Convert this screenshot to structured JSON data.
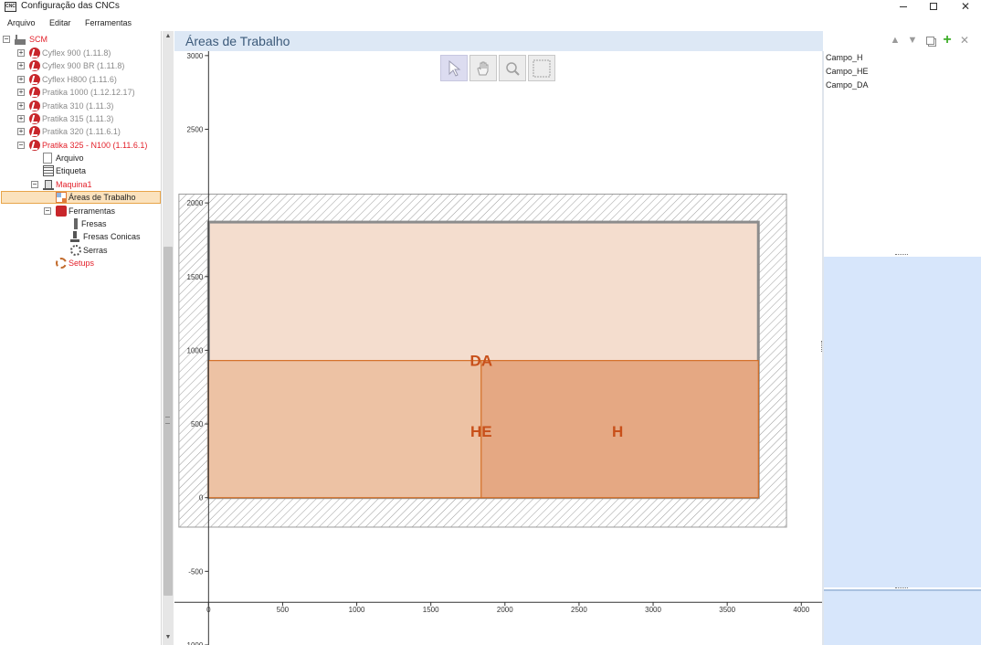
{
  "window": {
    "title": "Configuração das CNCs"
  },
  "menu": {
    "items": [
      "Arquivo",
      "Editar",
      "Ferramentas"
    ]
  },
  "tree": {
    "root": "SCM",
    "machines": [
      "Cyflex 900 (1.11.8)",
      "Cyflex 900 BR (1.11.8)",
      "Cyflex H800 (1.11.6)",
      "Pratika 1000 (1.12.12.17)",
      "Pratika 310 (1.11.3)",
      "Pratika 315 (1.11.3)",
      "Pratika 320 (1.11.6.1)",
      "Pratika 325 - N100 (1.11.6.1)"
    ],
    "children": {
      "arquivo": "Arquivo",
      "etiqueta": "Etiqueta",
      "maquina": "Maquina1",
      "areas": "Áreas de Trabalho",
      "ferramentas": "Ferramentas",
      "fresas": "Fresas",
      "fresas_conicas": "Fresas Conicas",
      "serras": "Serras",
      "setups": "Setups"
    },
    "colors": {
      "normal": "#8b8b8b",
      "active": "#e3212b",
      "default": "#1e1e1e",
      "selected_bg": "#fbe2bd",
      "selected_border": "#e8a54a"
    }
  },
  "header": {
    "title": "Áreas de Trabalho",
    "icons": [
      "arrow-up-icon",
      "arrow-down-icon",
      "copy-icon",
      "plus-icon",
      "close-icon"
    ]
  },
  "tools": [
    "select-icon",
    "pan-hand-icon",
    "zoom-icon",
    "zoom-rect-icon"
  ],
  "chart_data": {
    "type": "area-layout",
    "x_ticks": [
      0,
      500,
      1000,
      1500,
      2000,
      2500,
      3000,
      3500,
      4000
    ],
    "y_ticks": [
      3000,
      2500,
      2000,
      1500,
      1000,
      500,
      0,
      -500,
      -1000
    ],
    "xlim": [
      -230,
      4140
    ],
    "ylim": [
      -1000,
      3030
    ],
    "table": {
      "x": [
        -200,
        3900
      ],
      "y": [
        -200,
        2060
      ],
      "hatch_color": "#9b9b9b"
    },
    "panel": {
      "x": [
        0,
        3710
      ],
      "y": [
        0,
        1870
      ],
      "fill": "#f4ddce",
      "border": "#8c8c8c"
    },
    "areas": [
      {
        "name": "DA",
        "x": [
          0,
          3710
        ],
        "y": [
          0,
          930
        ],
        "fill": "#edc2a4",
        "label_at": [
          1840,
          930
        ]
      },
      {
        "name": "HE",
        "x": [
          0,
          1840
        ],
        "y": [
          0,
          930
        ],
        "fill": "#edc2a4",
        "label_at": [
          1840,
          450
        ]
      },
      {
        "name": "H",
        "x": [
          1840,
          3710
        ],
        "y": [
          0,
          930
        ],
        "fill": "#e5a883",
        "label_at": [
          2760,
          450
        ]
      }
    ],
    "outline_color": "#d2691e"
  },
  "fields": [
    "Campo_H",
    "Campo_HE",
    "Campo_DA"
  ]
}
